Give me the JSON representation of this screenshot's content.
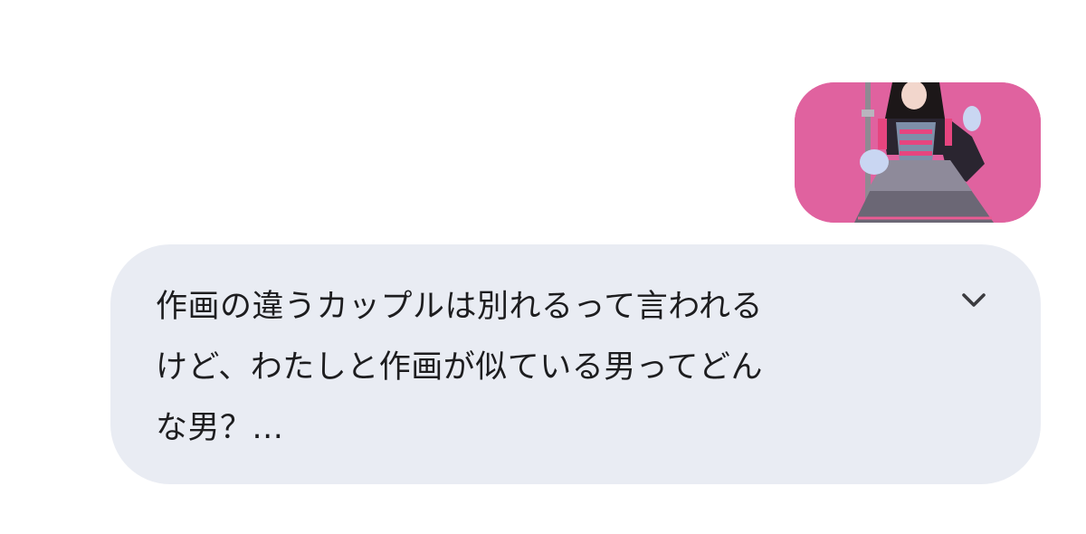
{
  "conversation": {
    "user_message": {
      "attachment": {
        "icon": "photo-thumbnail",
        "background_color": "#e0629f"
      }
    },
    "assistant_message": {
      "text": "作画の違うカップルは別れるって言われる\nけど、わたしと作画が似ている男ってどん\nな男？...",
      "expand_icon": "chevron-down-icon",
      "bubble_color": "#e9ecf3"
    }
  }
}
